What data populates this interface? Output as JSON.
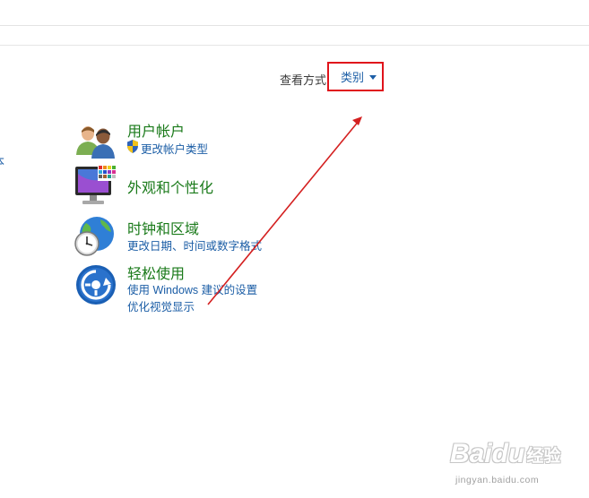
{
  "toolbar": {
    "view_by_label": "查看方式",
    "view_by_value": "类别"
  },
  "left_panel": {
    "truncated_link": "本"
  },
  "categories": [
    {
      "title": "用户帐户",
      "icon": "user-accounts-icon",
      "links": [
        "更改帐户类型"
      ],
      "link_icons": [
        "shield-icon"
      ]
    },
    {
      "title": "外观和个性化",
      "icon": "appearance-personalization-icon",
      "links": []
    },
    {
      "title": "时钟和区域",
      "icon": "clock-region-icon",
      "links": [
        "更改日期、时间或数字格式"
      ]
    },
    {
      "title": "轻松使用",
      "icon": "ease-of-access-icon",
      "links": [
        "使用 Windows 建议的设置",
        "优化视觉显示"
      ]
    }
  ],
  "annotation": {
    "highlight_color": "#e0131b",
    "arrow_color": "#d42020"
  },
  "watermark": {
    "brand": "Baidu",
    "suffix": "经验",
    "url": "jingyan.baidu.com"
  },
  "colors": {
    "link_blue": "#1c5ea6",
    "category_green": "#1a7a1a"
  }
}
